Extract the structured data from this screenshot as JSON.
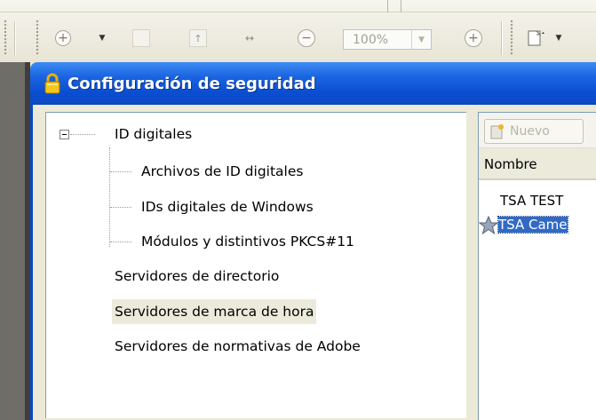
{
  "toolbar": {
    "zoom_value": "100%",
    "icons": [
      "zoom-in-icon",
      "dropdown-arrow-icon",
      "blank-page-icon",
      "fit-page-icon",
      "fit-width-icon",
      "zoom-out-icon",
      "zoom-plus-icon",
      "page-layout-icon"
    ]
  },
  "dialog": {
    "title": "Configuración de seguridad",
    "title_icon": "lock-icon",
    "tree": {
      "root": "ID digitales",
      "children": [
        "Archivos de ID digitales",
        "IDs digitales de Windows",
        "Módulos y distintivos PKCS#11"
      ],
      "items": [
        "Servidores de directorio",
        "Servidores de marca de hora",
        "Servidores de normativas de Adobe"
      ],
      "selected": "Servidores de marca de hora"
    },
    "right_panel": {
      "new_button": "Nuevo",
      "column_header": "Nombre",
      "rows": [
        {
          "label": "TSA TEST",
          "icon": "",
          "selected": false
        },
        {
          "label": "TSA Came",
          "icon": "star-icon",
          "selected": true
        }
      ]
    }
  },
  "colors": {
    "titlebar": "#0b48c2",
    "selection": "#316ac5",
    "tree_selected_bg": "#eceadb"
  }
}
